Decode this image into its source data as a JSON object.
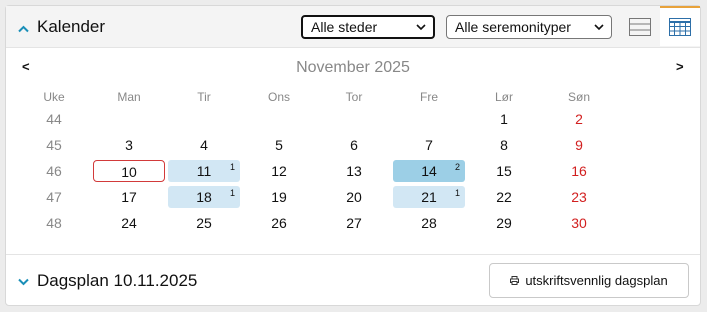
{
  "header": {
    "title": "Kalender",
    "places_select": "Alle steder",
    "ceremony_select": "Alle seremonityper"
  },
  "calendar": {
    "month_title": "November 2025",
    "prev": "<",
    "next": ">",
    "weekday_headers": [
      "Uke",
      "Man",
      "Tir",
      "Ons",
      "Tor",
      "Fre",
      "Lør",
      "Søn"
    ],
    "weeks": [
      {
        "week": "44",
        "days": [
          "",
          "",
          "",
          "",
          "1",
          "2"
        ],
        "sun_index": 6
      },
      {
        "week": "45",
        "days": [
          "3",
          "4",
          "5",
          "6",
          "7",
          "8",
          "9"
        ]
      },
      {
        "week": "46",
        "days": [
          "10",
          "11",
          "12",
          "13",
          "14",
          "15",
          "16"
        ]
      },
      {
        "week": "47",
        "days": [
          "17",
          "18",
          "19",
          "20",
          "21",
          "22",
          "23"
        ]
      },
      {
        "week": "48",
        "days": [
          "24",
          "25",
          "26",
          "27",
          "28",
          "29",
          "30"
        ]
      }
    ],
    "badges": {
      "11": "1",
      "14": "2",
      "18": "1",
      "21": "1"
    },
    "selected_day": "10"
  },
  "footer": {
    "title": "Dagsplan 10.11.2025",
    "print_label": "utskriftsvennlig dagsplan"
  },
  "colors": {
    "accent": "#1a8fb8",
    "sunday": "#d21f1f",
    "event": "#d2e7f4",
    "event_strong": "#9ccfe6",
    "tab_active": "#e8a23a"
  }
}
